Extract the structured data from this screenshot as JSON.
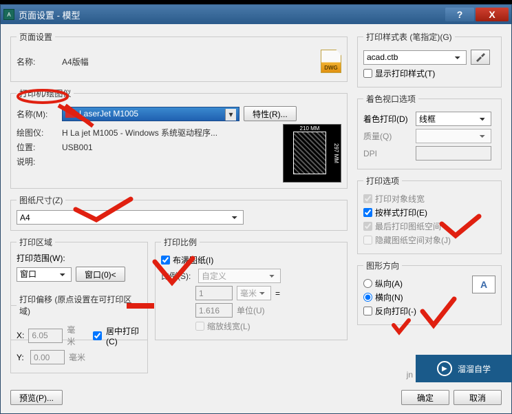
{
  "window": {
    "title": "页面设置 - 模型"
  },
  "page_setup": {
    "legend": "页面设置",
    "name_label": "名称:",
    "name_value": "A4版幅",
    "dwg_badge": "DWG"
  },
  "printer": {
    "legend": "打印机/绘图仪",
    "name_label": "名称(M):",
    "selected": "LaserJet M1005",
    "props_btn": "特性(R)...",
    "plotter_label": "绘图仪:",
    "plotter_value": "H  La   jet M1005 - Windows 系统驱动程序...",
    "location_label": "位置:",
    "location_value": "USB001",
    "desc_label": "说明:",
    "preview_w": "210 MM",
    "preview_h": "297 MM"
  },
  "paper": {
    "legend": "图纸尺寸(Z)",
    "selected": "A4"
  },
  "area": {
    "legend": "打印区域",
    "range_label": "打印范围(W):",
    "selected": "窗口",
    "window_btn": "窗口(0)<"
  },
  "offset": {
    "legend": "打印偏移 (原点设置在可打印区域)",
    "x_label": "X:",
    "x_value": "6.05",
    "x_unit": "毫米",
    "y_label": "Y:",
    "y_value": "0.00",
    "y_unit": "毫米",
    "center_label": "居中打印(C)"
  },
  "scale": {
    "legend": "打印比例",
    "fit_label": "布满图纸(I)",
    "ratio_label": "比例(S):",
    "ratio_value": "自定义",
    "num": "1",
    "num_unit": "毫米",
    "eq": "=",
    "den": "1.616",
    "den_unit": "单位(U)",
    "lw_label": "缩放线宽(L)"
  },
  "style": {
    "legend": "打印样式表 (笔指定)(G)",
    "selected": "acad.ctb",
    "show_label": "显示打印样式(T)"
  },
  "viewport": {
    "legend": "着色视口选项",
    "shade_label": "着色打印(D)",
    "shade_value": "线框",
    "quality_label": "质量(Q)",
    "dpi_label": "DPI"
  },
  "options": {
    "legend": "打印选项",
    "o1": "打印对象线宽",
    "o2": "按样式打印(E)",
    "o3": "最后打印图纸空间",
    "o4": "隐藏图纸空间对象(J)"
  },
  "orientation": {
    "legend": "图形方向",
    "portrait": "纵向(A)",
    "landscape": "横向(N)",
    "reverse": "反向打印(-)"
  },
  "footer": {
    "preview": "预览(P)...",
    "ok": "确定",
    "cancel": "取消"
  },
  "watermark": "溜溜自学",
  "jn": "jn"
}
